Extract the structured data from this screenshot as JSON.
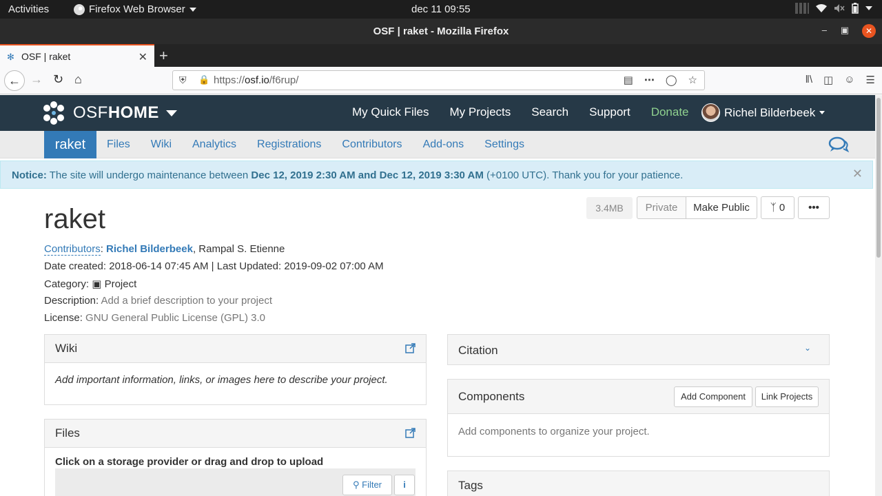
{
  "gnome": {
    "activities": "Activities",
    "app_menu": "Firefox Web Browser",
    "clock": "dec 11  09:55"
  },
  "window": {
    "title": "OSF | raket - Mozilla Firefox"
  },
  "tabs": [
    {
      "label": "OSF | raket",
      "icon": "osf-favicon-icon"
    }
  ],
  "url": {
    "prefix": "https://",
    "host": "osf.io",
    "path": "/f6rup/"
  },
  "osf_nav": {
    "brand_light": "OSF",
    "brand_bold": "HOME",
    "links": [
      "My Quick Files",
      "My Projects",
      "Search",
      "Support",
      "Donate"
    ],
    "user": "Richel Bilderbeek",
    "donate_color": "#8fd18f"
  },
  "project_nav": {
    "active": "raket",
    "items": [
      "Files",
      "Wiki",
      "Analytics",
      "Registrations",
      "Contributors",
      "Add-ons",
      "Settings"
    ]
  },
  "notice": {
    "label": "Notice:",
    "text1": " The site will undergo maintenance between ",
    "date1": "Dec 12, 2019 2:30 AM",
    "and": " and ",
    "date2": "Dec 12, 2019 3:30 AM",
    "text2": " (+0100 UTC). Thank you for your patience."
  },
  "project": {
    "title": "raket",
    "size": "3.4MB",
    "private_label": "Private",
    "make_public_label": "Make Public",
    "fork_count": "0",
    "more_label": "•••",
    "contributors_label": "Contributors",
    "contributor_1": "Richel Bilderbeek",
    "contributor_sep": ", ",
    "contributor_2": "Rampal S. Etienne",
    "date_created_label": "Date created:",
    "date_created": "2018-06-14 07:45 AM",
    "last_updated_label": "Last Updated:",
    "last_updated": "2019-09-02 07:00 AM",
    "category_label": "Category:",
    "category": "Project",
    "description_label": "Description:",
    "description": "Add a brief description to your project",
    "license_label": "License:",
    "license": "GNU General Public License (GPL) 3.0"
  },
  "panels": {
    "wiki": {
      "title": "Wiki",
      "body": "Add important information, links, or images here to describe your project."
    },
    "files": {
      "title": "Files",
      "instructions": "Click on a storage provider or drag and drop to upload",
      "filter_label": "Filter"
    },
    "citation": {
      "title": "Citation"
    },
    "components": {
      "title": "Components",
      "add_label": "Add Component",
      "link_label": "Link Projects",
      "body": "Add components to organize your project."
    },
    "tags": {
      "title": "Tags"
    }
  },
  "colors": {
    "accent": "#337ab7",
    "osf_nav_bg": "#263947",
    "notice_bg": "#d9edf7",
    "ubuntu_orange": "#e95420"
  }
}
